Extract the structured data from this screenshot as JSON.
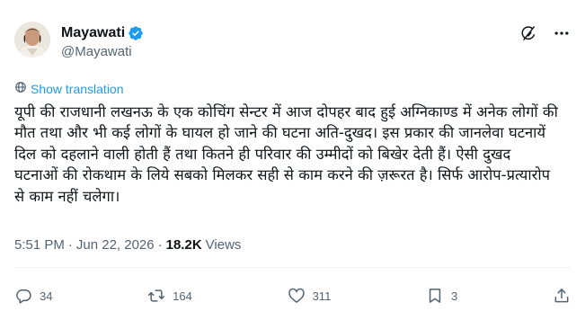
{
  "author": {
    "name": "Mayawati",
    "handle": "@Mayawati"
  },
  "translate_label": "Show translation",
  "text": "यूपी की राजधानी लखनऊ के एक कोचिंग सेन्टर में आज दोपहर बाद हुई अग्निकाण्ड में अनेक लोगों की मौत तथा और भी कई लोगों के घायल हो जाने की घटना अति-दुखद। इस प्रकार की जानलेवा घटनायें दिल को दहलाने वाली होती हैं तथा कितने ही परिवार की उम्मीदों को बिखेर देती हैं। ऐसी दुखद घटनाओं की रोकथाम के लिये सबको मिलकर सही से काम करने की ज़रूरत है। सिर्फ आरोप-प्रत्यारोप से काम नहीं चलेगा।",
  "meta": {
    "time": "5:51 PM",
    "separator": "·",
    "date": "Jun 22, 2026",
    "views_count": "18.2K",
    "views_label": "Views"
  },
  "actions": {
    "replies": "34",
    "reposts": "164",
    "likes": "311",
    "bookmarks": "3"
  },
  "colors": {
    "link": "#1d9bf0",
    "secondary_text": "#536471",
    "verified_badge": "#1d9bf0"
  },
  "icons": [
    "verified-badge-icon",
    "grok-icon",
    "more-icon",
    "translate-icon",
    "reply-icon",
    "repost-icon",
    "like-icon",
    "bookmark-icon",
    "share-icon"
  ]
}
